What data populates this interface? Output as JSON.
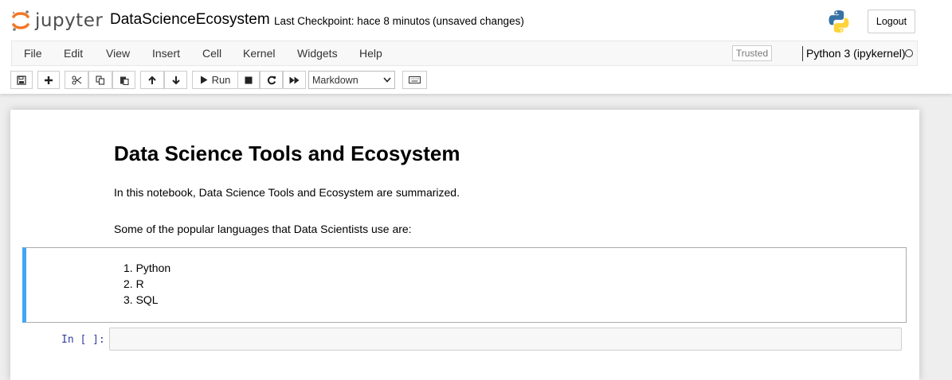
{
  "header": {
    "logo_text": "jupyter",
    "notebook_name": "DataScienceEcosystem",
    "checkpoint": "Last Checkpoint: hace 8 minutos",
    "autosave_status": "(unsaved changes)",
    "logout_label": "Logout"
  },
  "menu": {
    "items": [
      "File",
      "Edit",
      "View",
      "Insert",
      "Cell",
      "Kernel",
      "Widgets",
      "Help"
    ],
    "trusted_label": "Trusted",
    "kernel_name": "Python 3 (ipykernel)"
  },
  "toolbar": {
    "run_label": "Run",
    "cell_type": "Markdown",
    "icons": [
      "save-icon",
      "plus-icon",
      "cut-icon",
      "copy-icon",
      "paste-icon",
      "arrow-up-icon",
      "arrow-down-icon",
      "play-icon",
      "stop-icon",
      "restart-icon",
      "fast-forward-icon",
      "keyboard-icon"
    ]
  },
  "notebook": {
    "heading": "Data Science Tools and Ecosystem",
    "intro": "In this notebook, Data Science Tools and Ecosystem are summarized.",
    "languages_intro": "Some of the popular languages that Data Scientists use are:",
    "languages": [
      "1. Python",
      "2. R",
      "3. SQL"
    ],
    "input_prompt": "In [ ]:"
  },
  "colors": {
    "selected_cell_border": "#42a5f5",
    "prompt": "#303f9f",
    "logo_orange": "#f37726"
  }
}
